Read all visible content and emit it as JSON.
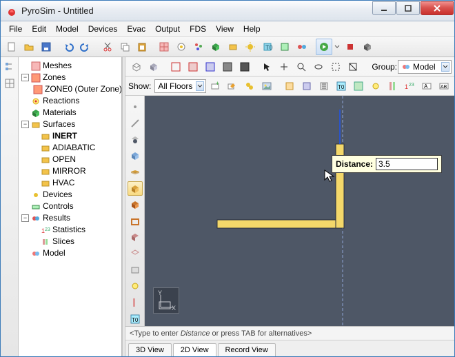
{
  "app": {
    "title": "PyroSim - Untitled"
  },
  "menu": [
    "File",
    "Edit",
    "Model",
    "Devices",
    "Evac",
    "Output",
    "FDS",
    "View",
    "Help"
  ],
  "group_label": "Group:",
  "group_value": "Model",
  "show_label": "Show:",
  "show_value": "All Floors",
  "tree": {
    "meshes": "Meshes",
    "zones": "Zones",
    "zone0": "ZONE0 (Outer Zone)",
    "reactions": "Reactions",
    "materials": "Materials",
    "surfaces": "Surfaces",
    "inert": "INERT",
    "adiabatic": "ADIABATIC",
    "open": "OPEN",
    "mirror": "MIRROR",
    "hvac": "HVAC",
    "devices": "Devices",
    "controls": "Controls",
    "results": "Results",
    "statistics": "Statistics",
    "slices": "Slices",
    "model": "Model"
  },
  "distance": {
    "label": "Distance:",
    "value": "3.5"
  },
  "status": "<Type to enter Distance or press TAB for alternatives>",
  "tabs": {
    "t1": "3D View",
    "t2": "2D View",
    "t3": "Record View"
  },
  "axis": {
    "x": "X",
    "y": "Y"
  }
}
